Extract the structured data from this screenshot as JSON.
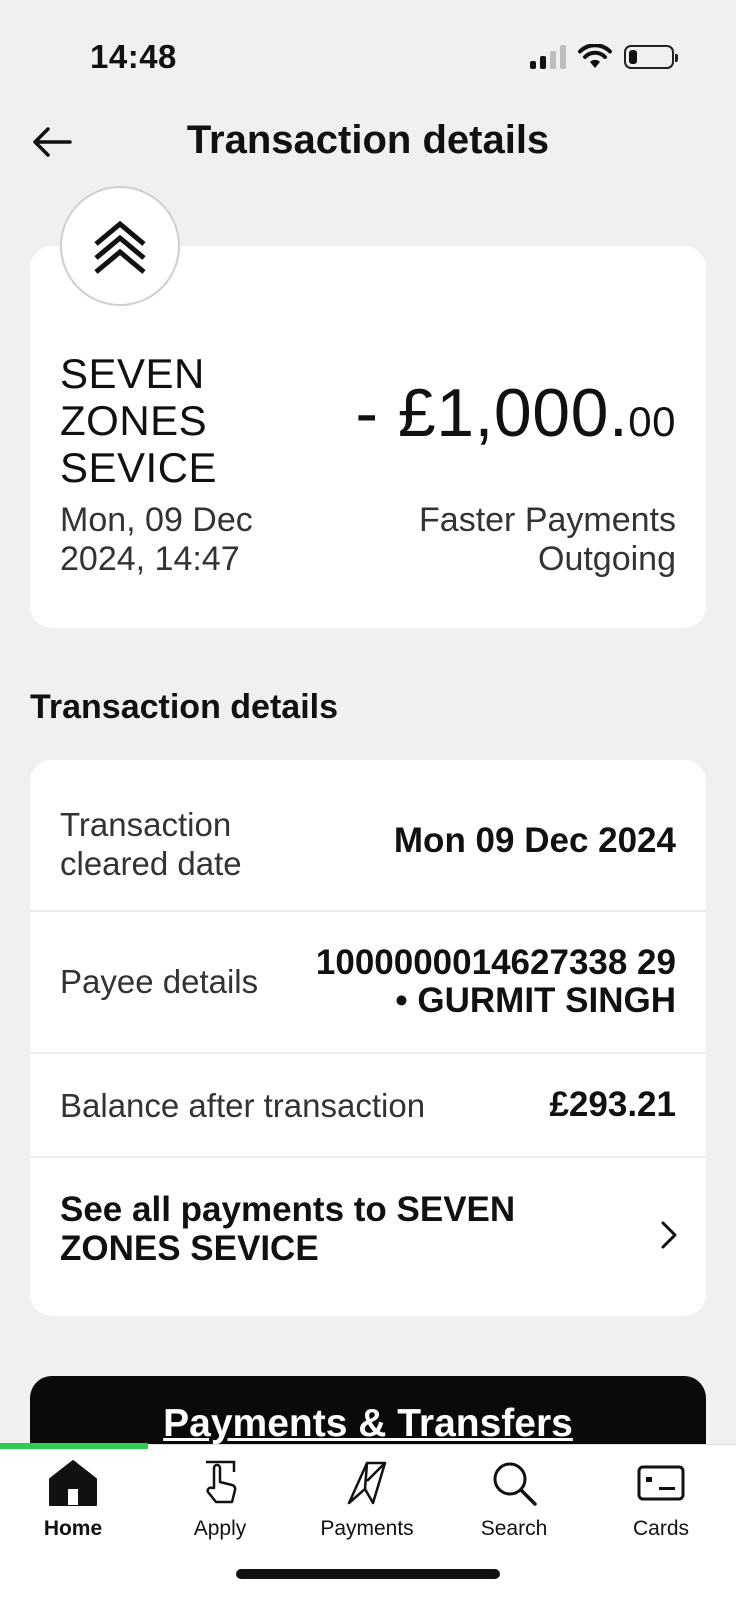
{
  "status_bar": {
    "time": "14:48",
    "battery_level_percent": 20
  },
  "header": {
    "title": "Transaction details",
    "back_icon": "arrow-left-icon"
  },
  "summary": {
    "merchant_name": "SEVEN ZONES SEVICE",
    "date": "Mon, 09 Dec 2024, 14:47",
    "amount_major": "- £1,000.",
    "amount_minor": "00",
    "payment_type": "Faster Payments Outgoing",
    "logo_icon": "double-chevron-up-icon"
  },
  "details": {
    "heading": "Transaction details",
    "rows": [
      {
        "label": "Transaction cleared date",
        "value": "Mon 09 Dec 2024"
      },
      {
        "label": "Payee details",
        "value": "1000000014627338 29 • GURMIT SINGH"
      },
      {
        "label": "Balance after transaction",
        "value": "£293.21"
      }
    ],
    "see_all_label": "See all payments to SEVEN ZONES SEVICE"
  },
  "payments_transfers_button": "Payments & Transfers",
  "tabs": [
    {
      "label": "Home",
      "icon": "home-icon",
      "active": true
    },
    {
      "label": "Apply",
      "icon": "tap-hand-icon",
      "active": false
    },
    {
      "label": "Payments",
      "icon": "payments-icon",
      "active": false
    },
    {
      "label": "Search",
      "icon": "search-icon",
      "active": false
    },
    {
      "label": "Cards",
      "icon": "card-icon",
      "active": false
    }
  ],
  "colors": {
    "background": "#f0f0f0",
    "card": "#ffffff",
    "accent_green": "#2ecc52",
    "button_dark": "#0a0a0a"
  }
}
